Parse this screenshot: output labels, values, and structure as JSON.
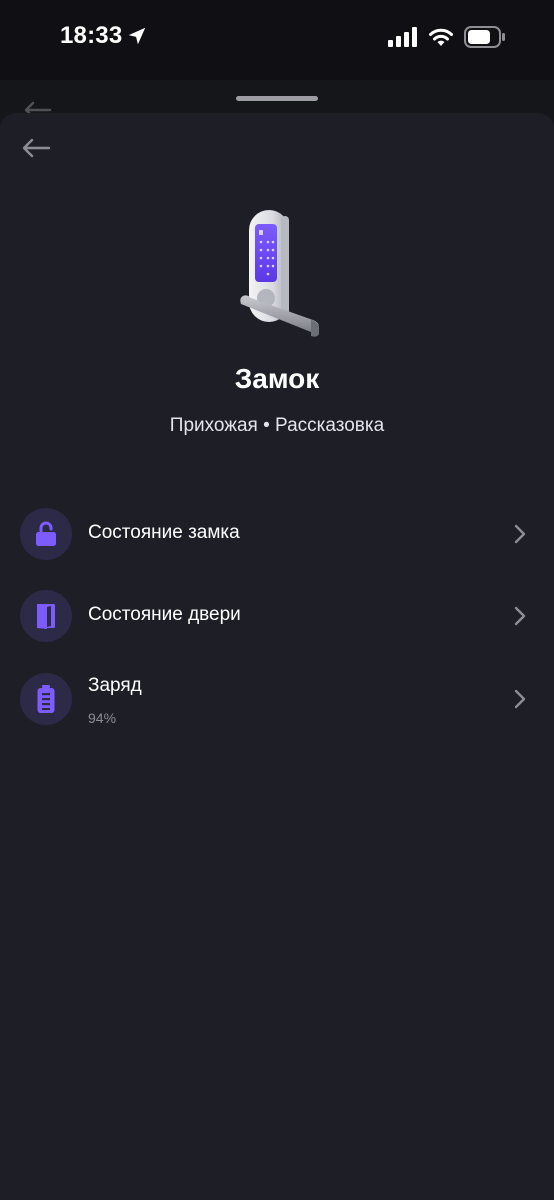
{
  "status_bar": {
    "time": "18:33",
    "icons": [
      "location-arrow-icon",
      "cellular-signal-icon",
      "wifi-icon",
      "battery-icon"
    ]
  },
  "device": {
    "title": "Замок",
    "subtitle": "Прихожая • Рассказовка",
    "image": "smart-lock-image"
  },
  "rows": [
    {
      "label": "Состояние замка",
      "icon": "unlocked-padlock-icon"
    },
    {
      "label": "Состояние двери",
      "icon": "open-door-icon"
    },
    {
      "label": "Заряд",
      "sub": "94%",
      "icon": "battery-level-icon"
    }
  ],
  "colors": {
    "background": "#1e1f26",
    "icon_circle": "#2d2a47",
    "accent_purple": "#7c5cff",
    "secondary_text": "#8c8d96"
  }
}
